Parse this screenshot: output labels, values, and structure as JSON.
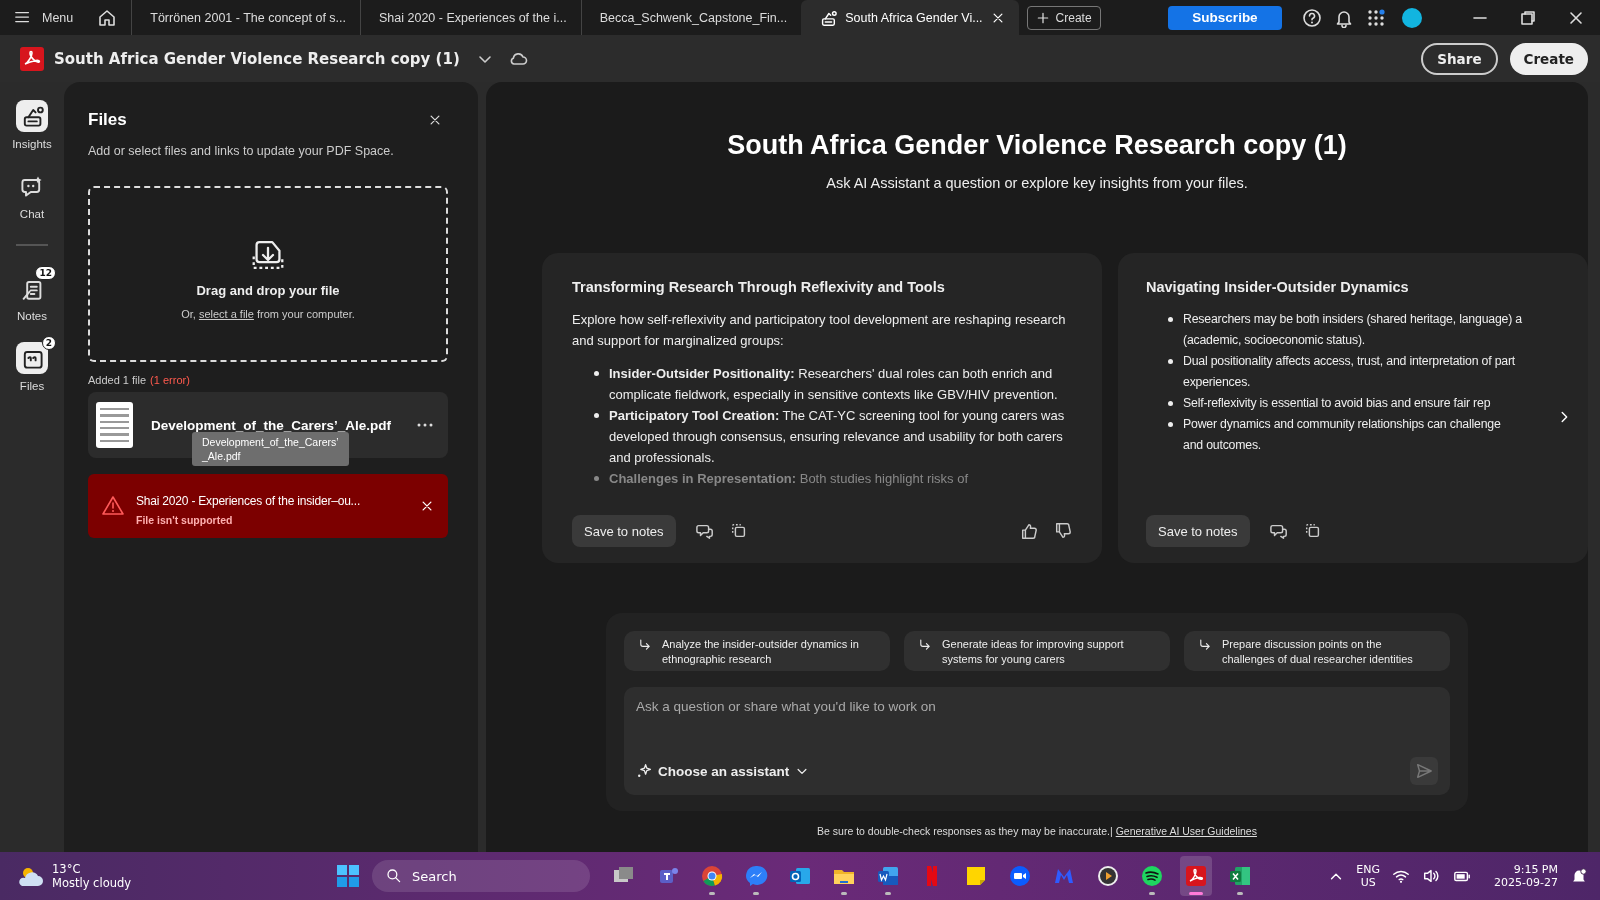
{
  "tab_bar": {
    "menu": "Menu",
    "tabs": [
      {
        "label": "Törrönen 2001 - The concept of s...",
        "selected": false
      },
      {
        "label": "Shai 2020 - Experiences of the i...",
        "selected": false
      },
      {
        "label": "Becca_Schwenk_Capstone_Fin...",
        "selected": false
      },
      {
        "label": "South Africa Gender Vi...",
        "selected": true
      }
    ],
    "new_tab": "Create",
    "subscribe": "Subscribe"
  },
  "title_bar": {
    "title": "South Africa Gender Violence Research copy (1)",
    "share": "Share",
    "create": "Create"
  },
  "rail": {
    "top": [
      {
        "kind": "insights",
        "label": "Insights",
        "selected": true
      },
      {
        "kind": "chat",
        "label": "Chat",
        "selected": false
      }
    ],
    "bottom": [
      {
        "kind": "notes",
        "label": "Notes",
        "badge": "12",
        "selected": false
      },
      {
        "kind": "files",
        "label": "Files",
        "badge": "2",
        "selected": true
      }
    ]
  },
  "files_panel": {
    "title": "Files",
    "description": "Add or select files and links to update your PDF Space.",
    "dropzone": {
      "heading": "Drag and drop your file",
      "hint_before": "Or,",
      "link": "select a file",
      "hint_after": "from your computer."
    },
    "summary": "Added 1 file",
    "errors": "(1 error)",
    "files": [
      {
        "kind": "file",
        "name": "Development_of_the_Carers’_Ale.pdf"
      },
      {
        "kind": "error",
        "name": "Shai 2020 - Experiences of the insider–ou...",
        "message": "File isn't supported"
      }
    ],
    "tooltip": [
      "Development_of_the_Carers’",
      "_Ale.pdf"
    ]
  },
  "main": {
    "heading": "South Africa Gender Violence Research copy (1)",
    "subtitle": "Ask AI Assistant a question or explore key insights from your files.",
    "cards": [
      {
        "title": "Transforming Research Through Reflexivity and Tools",
        "intro": "Explore how self-reflexivity and participatory tool development are reshaping research and support for marginalized groups:",
        "bullets": [
          {
            "text": "**Insider-Outsider Positionality:** Researchers' dual roles can both enrich and complicate fieldwork, especially in sensitive contexts like GBV/HIV prevention.",
            "faded": false
          },
          {
            "text": "**Participatory Tool Creation:** The CAT-YC screening tool for young carers was developed through consensus, ensuring relevance and usability for both carers and professionals.",
            "faded": false
          },
          {
            "text": "**Challenges in Representation:** Both studies highlight risks of",
            "faded": true
          }
        ],
        "save": "Save to notes",
        "rating": true
      },
      {
        "title": "Navigating Insider-Outsider Dynamics",
        "bullets": [
          {
            "lines": [
              "Researchers may be both insiders (shared heritage, language) a",
              "(academic, socioeconomic status)."
            ],
            "faded": false
          },
          {
            "lines": [
              "Dual positionality affects access, trust, and interpretation of part",
              "experiences."
            ],
            "faded": false
          },
          {
            "lines": [
              "Self-reflexivity is essential to avoid bias and ensure fair rep"
            ],
            "faded": false
          },
          {
            "lines": [
              "Power dynamics and community relationships can challenge",
              "and outcomes."
            ],
            "faded": false
          }
        ],
        "save": "Save to notes",
        "rating": false
      }
    ],
    "suggestions": [
      "Analyze the insider-outsider dynamics in ethnographic research",
      "Generate ideas for improving support systems for young carers",
      "Prepare discussion points on the challenges of dual researcher identities"
    ],
    "placeholder": "Ask a question or share what you'd like to work on",
    "assistant": "Choose an assistant",
    "send_disabled": true,
    "disclaimer": "Be sure to double-check responses as they may be inaccurate.|",
    "guidelines": "Generative AI User Guidelines"
  },
  "taskbar": {
    "temperature": "13°C",
    "weather": "Mostly cloudy",
    "search": "Search",
    "apps": [
      {
        "kind": "taskview",
        "running": false,
        "active": false
      },
      {
        "kind": "teams",
        "running": false,
        "active": false
      },
      {
        "kind": "chrome",
        "running": true,
        "active": false
      },
      {
        "kind": "messenger",
        "running": true,
        "active": false
      },
      {
        "kind": "outlook",
        "running": false,
        "active": false
      },
      {
        "kind": "explorer",
        "running": true,
        "active": false
      },
      {
        "kind": "word",
        "running": true,
        "active": false
      },
      {
        "kind": "netflix",
        "running": false,
        "active": false
      },
      {
        "kind": "sticky",
        "running": false,
        "active": false
      },
      {
        "kind": "zoom",
        "running": false,
        "active": false
      },
      {
        "kind": "mbytes",
        "running": false,
        "active": false
      },
      {
        "kind": "player",
        "running": false,
        "active": false
      },
      {
        "kind": "spotify",
        "running": true,
        "active": false
      },
      {
        "kind": "acrobat",
        "running": true,
        "active": true
      },
      {
        "kind": "excel",
        "running": true,
        "active": false
      }
    ],
    "language": "ENG",
    "region": "US",
    "time": "9:15 PM",
    "date": "2025-09-27"
  }
}
